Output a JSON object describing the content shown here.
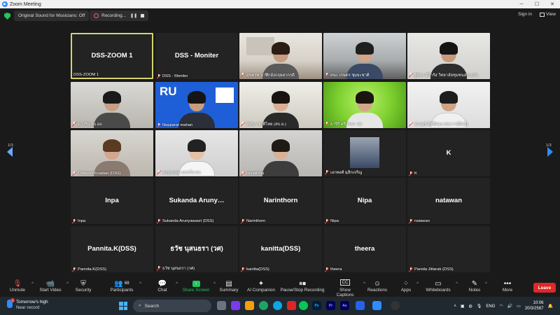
{
  "window": {
    "title": "Zoom Meeting"
  },
  "topbar": {
    "original_sound": "Original Sound for Musicians: Off",
    "recording": "Recording...",
    "signin": "Sign in",
    "view": "View"
  },
  "gallery": {
    "pager_left": "1/3",
    "pager_right": "1/3",
    "tiles": [
      {
        "caption": "DSS-ZOOM 1",
        "name": "DSS-ZOOM 1",
        "muted": false,
        "active": true
      },
      {
        "caption": "DSS - Moniter",
        "name": "DSS - Moniter",
        "muted": true
      },
      {
        "caption": "สุนทรพ นาฬิกอังกฤษยากรดี",
        "muted": true
      },
      {
        "caption": "คนะ เกษตร ชุมยะชาติ",
        "muted": true
      },
      {
        "caption": "ฐิติมา ดีจำรัส วิทยาลัยชุมชนสระแก้ว",
        "muted": true
      },
      {
        "caption": "ดาวรีน สบ.อง.",
        "muted": true
      },
      {
        "caption": "Nopparat mahan",
        "muted": true
      },
      {
        "caption": "ทัศนา ชาติไทย (สบ.อ.)",
        "muted": true
      },
      {
        "caption": "ธาริกี ศรีสาขา วศ",
        "muted": true
      },
      {
        "caption": "ปานสุรี ดีพิธีทอง (ปส.กาฬสินธุ์)",
        "muted": true
      },
      {
        "caption": "Thidarat Kruatian (DSS)",
        "muted": true
      },
      {
        "caption": "จารุวรรณ แตงเกิด ผจ.",
        "muted": true
      },
      {
        "caption": "penpitcha",
        "muted": true
      },
      {
        "caption": "เอกพงศ์ มุสิกเจริญ",
        "muted": true
      },
      {
        "caption": "K",
        "name": "K",
        "muted": true
      },
      {
        "caption": "Inpa",
        "name": "Inpa",
        "muted": true
      },
      {
        "caption": "Sukanda Arunyawasri (DSS)",
        "name": "Sukanda Aruny…",
        "muted": true
      },
      {
        "caption": "Narinthorn",
        "name": "Narinthorn",
        "muted": true
      },
      {
        "caption": "Nipa",
        "name": "Nipa",
        "muted": true
      },
      {
        "caption": "natawan",
        "name": "natawan",
        "muted": true
      },
      {
        "caption": "Pannita.K(DSS)",
        "name": "Pannita.K(DSS)",
        "muted": true
      },
      {
        "caption": "ธวัช นุสนธรา (วศ)",
        "name": "ธวัช นุสนธรา (วศ)",
        "muted": true
      },
      {
        "caption": "kanitta(DSS)",
        "name": "kanitta(DSS)",
        "muted": true
      },
      {
        "caption": "theera",
        "name": "theera",
        "muted": true
      },
      {
        "caption": "Panida Jittarak (DSS)",
        "name": "",
        "muted": true
      }
    ]
  },
  "toolbar": {
    "unmute": "Unmute",
    "start_video": "Start Video",
    "security": "Security",
    "participants": "Participants",
    "participants_count": "68",
    "chat": "Chat",
    "share_screen": "Share Screen",
    "summary": "Summary",
    "ai_companion": "AI Companion",
    "pause_stop_recording": "Pause/Stop Recording",
    "show_captions": "Show Captions",
    "reactions": "Reactions",
    "apps": "Apps",
    "whiteboards": "Whiteboards",
    "notes": "Notes",
    "more": "More",
    "leave": "Leave",
    "cc_label": "CC"
  },
  "taskbar": {
    "weather_title": "Tomorrow's high",
    "weather_sub": "Near record",
    "weather_badge": "1",
    "search": "Search",
    "lang": "ENG",
    "time": "10:06",
    "date": "20/3/2567",
    "apps": [
      "Ps",
      "Pr",
      "Ae"
    ]
  },
  "colors": {
    "accent": "#2d8cff",
    "leave": "#e02828",
    "share": "#22c55e",
    "active_border": "#d4d46c"
  }
}
